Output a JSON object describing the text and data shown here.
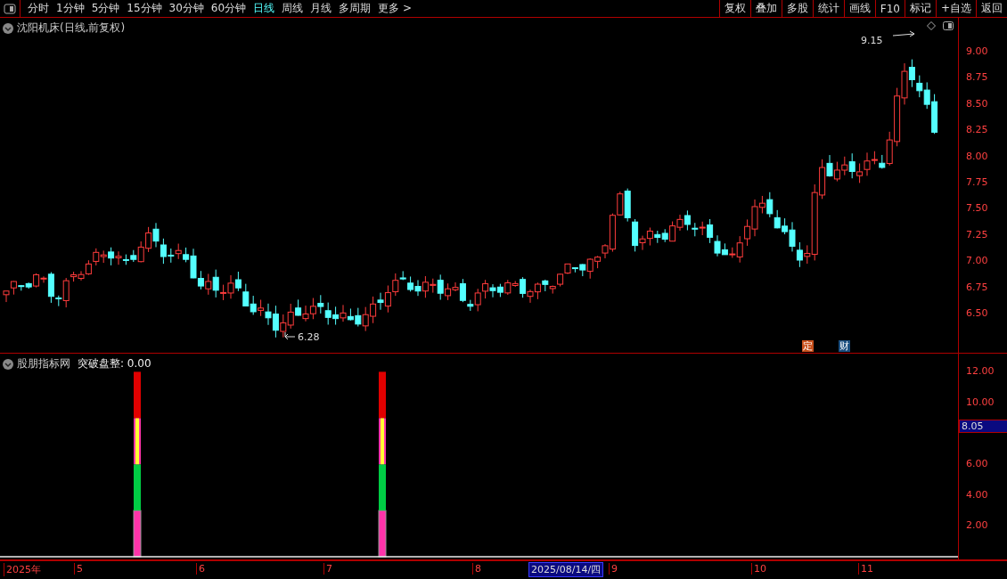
{
  "toolbar": {
    "periods": [
      {
        "label": "分时",
        "selected": false
      },
      {
        "label": "1分钟",
        "selected": false
      },
      {
        "label": "5分钟",
        "selected": false
      },
      {
        "label": "15分钟",
        "selected": false
      },
      {
        "label": "30分钟",
        "selected": false
      },
      {
        "label": "60分钟",
        "selected": false
      },
      {
        "label": "日线",
        "selected": true
      },
      {
        "label": "周线",
        "selected": false
      },
      {
        "label": "月线",
        "selected": false
      },
      {
        "label": "多周期",
        "selected": false
      },
      {
        "label": "更多 >",
        "selected": false
      }
    ],
    "buttons": [
      "复权",
      "叠加",
      "多股",
      "统计",
      "画线",
      "F10",
      "标记",
      "+自选",
      "返回"
    ]
  },
  "price_panel": {
    "title": "沈阳机床(日线,前复权)",
    "axis_labels": [
      "9.00",
      "8.75",
      "8.50",
      "8.25",
      "8.00",
      "7.75",
      "7.50",
      "7.25",
      "7.00",
      "6.75",
      "6.50"
    ],
    "high_label": "9.15",
    "low_label": "6.28",
    "event_badges": [
      {
        "label": "定",
        "kind": "announcement"
      },
      {
        "label": "财",
        "kind": "finance"
      }
    ]
  },
  "indicator_panel": {
    "source": "股朋指标网",
    "name": "突破盘整",
    "value": ": 0.00",
    "axis_labels": [
      "12.00",
      "10.00",
      "6.00",
      "4.00",
      "2.00"
    ],
    "crosshair_value": "8.05"
  },
  "date_bar": {
    "labels": [
      "2025年",
      "5",
      "6",
      "7",
      "8",
      "9",
      "10",
      "11"
    ],
    "cursor_date": "2025/08/14/四"
  }
}
